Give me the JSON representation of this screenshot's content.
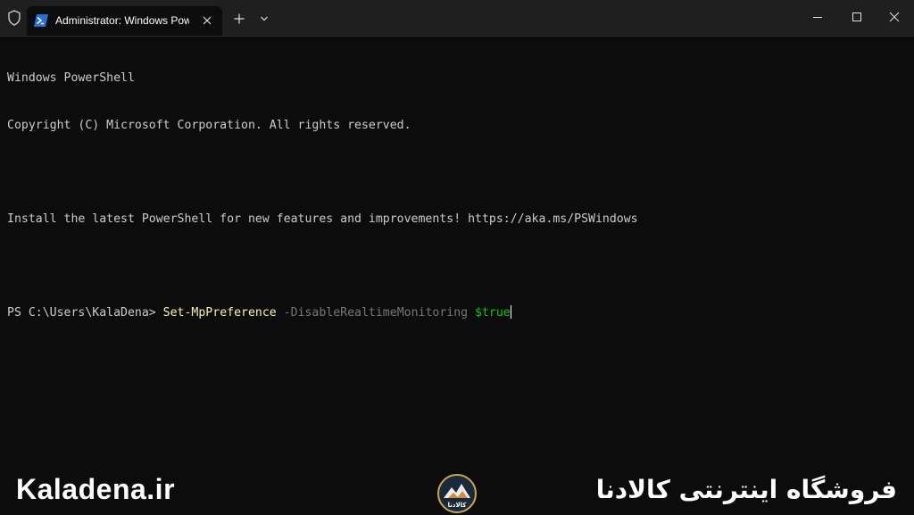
{
  "window": {
    "tab_title": "Administrator: Windows PowerShell",
    "new_tab_symbol": "+",
    "icons": {
      "shield": "shield-icon",
      "tab": "powershell-icon",
      "close_tab": "close-icon",
      "new_tab": "plus-icon",
      "dropdown": "chevron-down-icon",
      "minimize": "minimize-icon",
      "maximize": "maximize-icon",
      "close_window": "close-icon"
    }
  },
  "terminal": {
    "lines": [
      "Windows PowerShell",
      "Copyright (C) Microsoft Corporation. All rights reserved.",
      "",
      "Install the latest PowerShell for new features and improvements! https://aka.ms/PSWindows",
      ""
    ],
    "prompt": "PS C:\\Users\\KalaDena> ",
    "command": "Set-MpPreference",
    "parameter": " -DisableRealtimeMonitoring ",
    "value": "$true",
    "colors": {
      "background": "#0c0c0c",
      "text": "#cccccc",
      "command": "#f9f1a5",
      "parameter": "#767676",
      "value": "#16c60c"
    }
  },
  "watermark": {
    "left_text": "Kaladena.ir",
    "logo_text": "کالادنا",
    "right_text": "فروشگاه اینترنتی کالادنا"
  }
}
